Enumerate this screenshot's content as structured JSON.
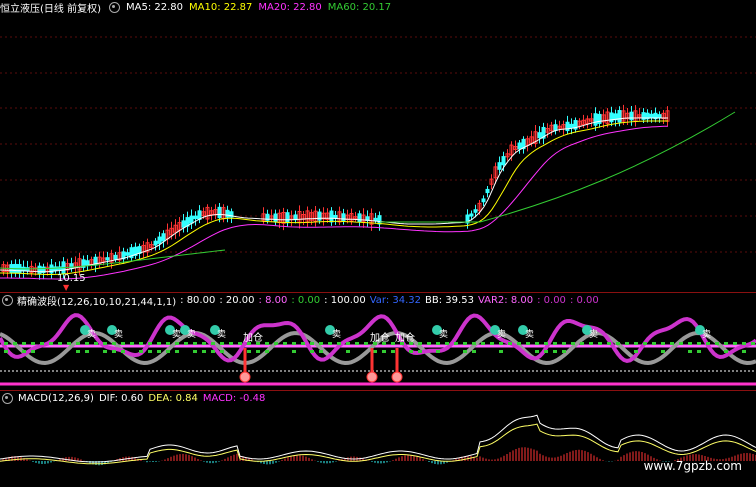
{
  "price_panel": {
    "title": "恒立液压(日线 前复权)",
    "ma5": "MA5: 22.80",
    "ma10": "MA10: 22.87",
    "ma20": "MA20: 22.80",
    "ma60": "MA60: 20.17",
    "low_label": "10.15",
    "colors": {
      "ma5": "#ffffff",
      "ma10": "#ffff00",
      "ma20": "#ff33ff",
      "ma60": "#33cc33",
      "up": "#ff3333",
      "down": "#33ffff"
    }
  },
  "indicator_panel": {
    "title": "精确波段(12,26,10,10,21,44,1,1)",
    "v1": ": 80.00",
    "v2": ": 20.00",
    "v3": ": 8.00",
    "v4": ": 0.00",
    "v5": ": 100.00",
    "var": "Var: 34.32",
    "bb": "BB: 39.53",
    "var2": "VAR2: 8.00",
    "v6": ": 0.00",
    "v7": ": 0.00",
    "sell_label": "卖",
    "add_label": "加仓",
    "colors": {
      "band": "#cc33cc",
      "grey": "#999999",
      "pink": "#ff66ff",
      "green": "#33cc33"
    }
  },
  "macd_panel": {
    "title": "MACD(12,26,9)",
    "dif": "DIF: 0.60",
    "dea": "DEA: 0.84",
    "macd": "MACD: -0.48",
    "colors": {
      "dif": "#ffffff",
      "dea": "#ffff66",
      "pos": "#ff3333",
      "neg": "#33ffff"
    }
  },
  "watermark": "www.7gpzb.com"
}
